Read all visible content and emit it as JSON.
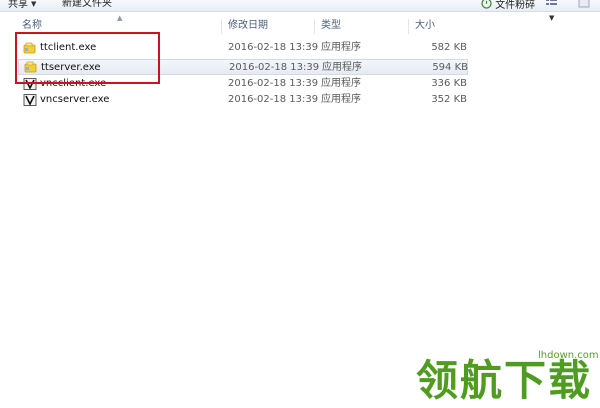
{
  "toolbar": {
    "share_label": "共享",
    "new_folder_label": "新建文件夹",
    "sync_label": "文件粉碎",
    "view_icon": "view-options-icon",
    "help_icon": "help-icon"
  },
  "columns": {
    "name": "名称",
    "date": "修改日期",
    "type": "类型",
    "size": "大小"
  },
  "files": [
    {
      "name": "ttclient.exe",
      "date": "2016-02-18 13:39",
      "type": "应用程序",
      "size": "582 KB",
      "icon": "yellow-app-icon"
    },
    {
      "name": "ttserver.exe",
      "date": "2016-02-18 13:39",
      "type": "应用程序",
      "size": "594 KB",
      "icon": "yellow-app-icon"
    },
    {
      "name": "vncclient.exe",
      "date": "2016-02-18 13:39",
      "type": "应用程序",
      "size": "336 KB",
      "icon": "vnc-app-icon"
    },
    {
      "name": "vncserver.exe",
      "date": "2016-02-18 13:39",
      "type": "应用程序",
      "size": "352 KB",
      "icon": "vnc-app-icon"
    }
  ],
  "watermark": {
    "url": "lhdown.com",
    "text": "领航下载"
  },
  "colors": {
    "highlight": "#c8141e",
    "watermark": "#4f9c21"
  }
}
